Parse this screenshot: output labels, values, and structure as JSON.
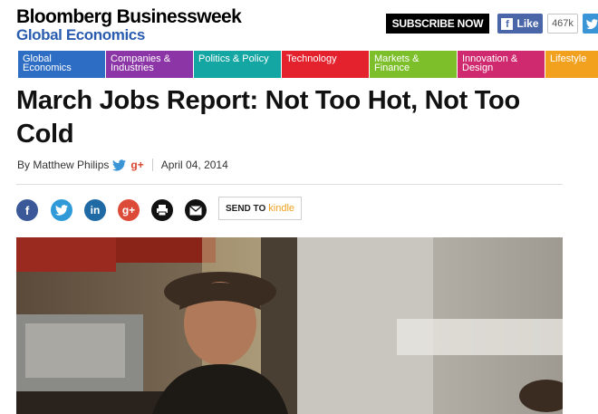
{
  "header": {
    "brand_line1": "Bloomberg Businessweek",
    "brand_line2": "Global Economics",
    "subscribe_label": "SUBSCRIBE NOW",
    "facebook_like_label": "Like",
    "facebook_like_count": "467k"
  },
  "nav": {
    "tabs": [
      {
        "label": "Global Economics",
        "color": "#2d6dc3"
      },
      {
        "label": "Companies & Industries",
        "color": "#8b35a6"
      },
      {
        "label": "Politics & Policy",
        "color": "#13a6a3"
      },
      {
        "label": "Technology",
        "color": "#e3222e"
      },
      {
        "label": "Markets & Finance",
        "color": "#7cbf2a"
      },
      {
        "label": "Innovation & Design",
        "color": "#cf2a6f"
      },
      {
        "label": "Lifestyle",
        "color": "#f2a11e"
      }
    ]
  },
  "article": {
    "title": "March Jobs Report: Not Too Hot, Not Too Cold",
    "byline": "By Matthew Philips",
    "date": "April 04, 2014",
    "send_to_label": "SEND TO",
    "kindle_label": "kindle",
    "share_icons": [
      "facebook-icon",
      "twitter-icon",
      "linkedin-icon",
      "google-plus-icon",
      "print-icon",
      "email-icon"
    ]
  }
}
